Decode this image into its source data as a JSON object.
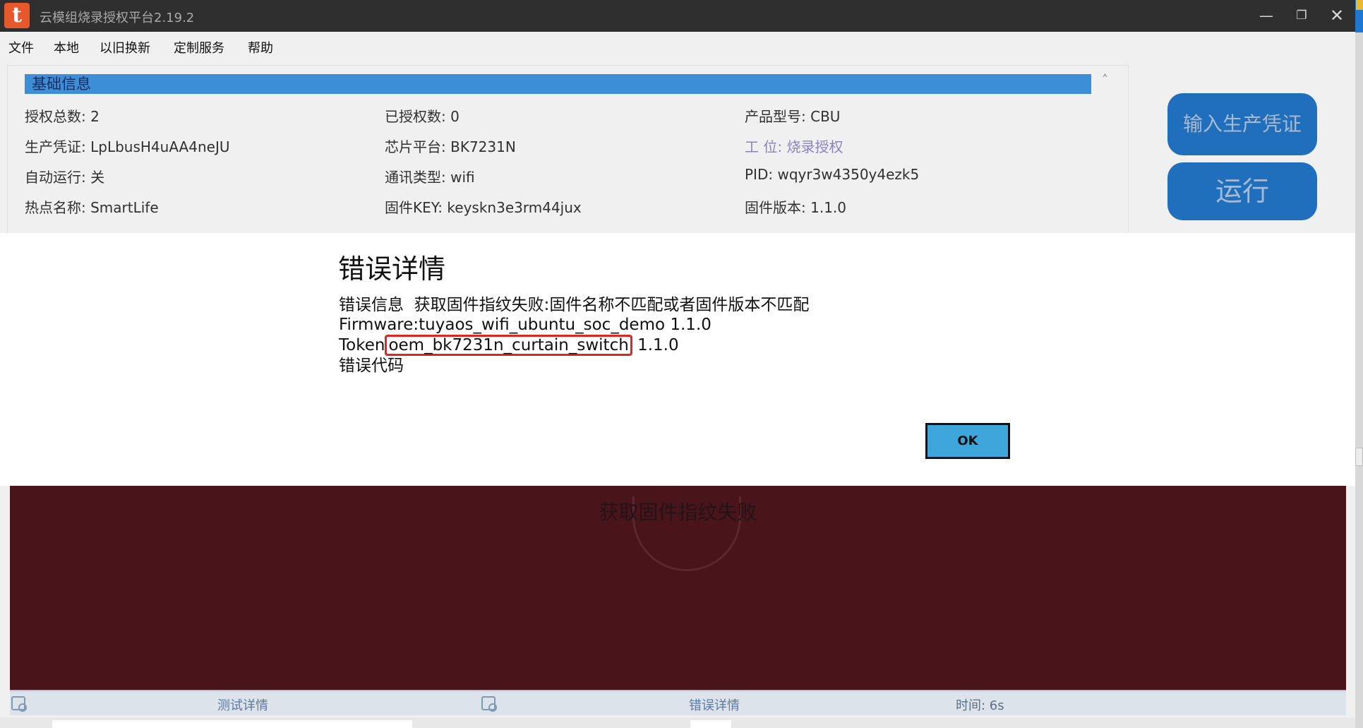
{
  "window": {
    "title": "云模组烧录授权平台2.19.2",
    "logo_letter": "t",
    "min_symbol": "—",
    "max_symbol": "❐",
    "close_symbol": "✕"
  },
  "menu": {
    "items": [
      {
        "label": "文件"
      },
      {
        "label": "本地"
      },
      {
        "label": "以旧换新"
      },
      {
        "label": "定制服务"
      },
      {
        "label": "帮助"
      }
    ]
  },
  "basic_info": {
    "header": "基础信息",
    "chevron": "˄",
    "rows": [
      [
        {
          "label": "授权总数: ",
          "value": "2"
        },
        {
          "label": "已授权数: ",
          "value": "0"
        },
        {
          "label": "产品型号: ",
          "value": "CBU"
        }
      ],
      [
        {
          "label": "生产凭证: ",
          "value": "LpLbusH4uAA4neJU"
        },
        {
          "label": "芯片平台: ",
          "value": "BK7231N"
        },
        {
          "label": "工 位: ",
          "value": "烧录授权"
        }
      ],
      [
        {
          "label": "自动运行: ",
          "value": "关"
        },
        {
          "label": "通讯类型: ",
          "value": "wifi"
        },
        {
          "label": "PID: ",
          "value": "wqyr3w4350y4ezk5"
        }
      ],
      [
        {
          "label": "热点名称: ",
          "value": "SmartLife"
        },
        {
          "label": "固件KEY: ",
          "value": "keyskn3e3rm44jux"
        },
        {
          "label": "固件版本: ",
          "value": "1.1.0"
        }
      ]
    ]
  },
  "actions": {
    "input_credential": "输入生产凭证",
    "run": "运行"
  },
  "dialog": {
    "title": "错误详情",
    "error_info_line": "错误信息  获取固件指纹失败:固件名称不匹配或者固件版本不匹配",
    "firmware_line": "Firmware:tuyaos_wifi_ubuntu_soc_demo 1.1.0",
    "token_prefix": "Token",
    "token_name": "oem_bk7231n_curtain_switch",
    "token_version": " 1.1.0",
    "error_code_label": "错误代码",
    "ok_label": "OK"
  },
  "status": {
    "message": "获取固件指纹失败",
    "test_details": "测试详情",
    "error_details": "错误详情",
    "time_label": "时间: ",
    "time_value": "6s",
    "colors": {
      "status_background": "#4a151a",
      "accent": "#3fa6dc",
      "highlight_box": "#e0261f"
    }
  }
}
